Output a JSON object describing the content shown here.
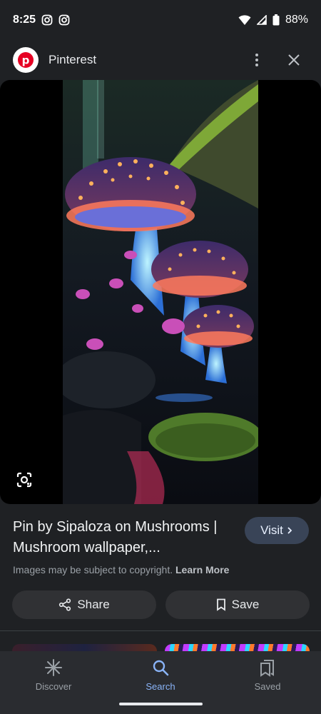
{
  "status_bar": {
    "time": "8:25",
    "battery": "88%",
    "notification_icons": [
      "instagram-icon",
      "instagram-icon"
    ],
    "system_icons": [
      "wifi-icon",
      "signal-icon",
      "battery-icon"
    ]
  },
  "header": {
    "app_name": "Pinterest",
    "logo_letter": "p",
    "brand_color": "#e60023"
  },
  "image": {
    "description_icon": "lens-icon"
  },
  "result": {
    "title": "Pin by Sipaloza on Mushrooms | Mushroom wallpaper,...",
    "visit_label": "Visit",
    "copyright_text": "Images may be subject to copyright.",
    "learn_more": "Learn More"
  },
  "actions": {
    "share_label": "Share",
    "save_label": "Save"
  },
  "bottom_nav": {
    "items": [
      {
        "label": "Discover",
        "icon": "discover-icon",
        "active": false
      },
      {
        "label": "Search",
        "icon": "search-icon",
        "active": true
      },
      {
        "label": "Saved",
        "icon": "saved-icon",
        "active": false
      }
    ]
  },
  "colors": {
    "accent": "#8ab4f8",
    "visit_bg": "#394457",
    "background": "#1f2124"
  }
}
